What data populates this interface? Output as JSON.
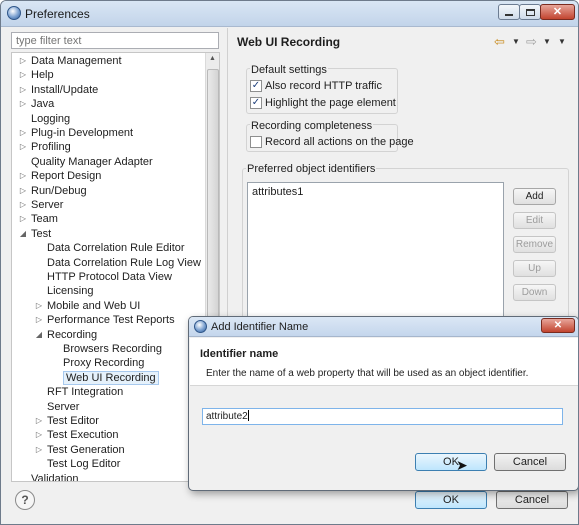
{
  "window": {
    "title": "Preferences"
  },
  "filter": {
    "placeholder": "type filter text"
  },
  "tree": [
    {
      "label": "Data Management",
      "indent": 0,
      "twisty": "collapsed"
    },
    {
      "label": "Help",
      "indent": 0,
      "twisty": "collapsed"
    },
    {
      "label": "Install/Update",
      "indent": 0,
      "twisty": "collapsed"
    },
    {
      "label": "Java",
      "indent": 0,
      "twisty": "collapsed"
    },
    {
      "label": "Logging",
      "indent": 0,
      "twisty": "none"
    },
    {
      "label": "Plug-in Development",
      "indent": 0,
      "twisty": "collapsed"
    },
    {
      "label": "Profiling",
      "indent": 0,
      "twisty": "collapsed"
    },
    {
      "label": "Quality Manager Adapter",
      "indent": 0,
      "twisty": "none"
    },
    {
      "label": "Report Design",
      "indent": 0,
      "twisty": "collapsed"
    },
    {
      "label": "Run/Debug",
      "indent": 0,
      "twisty": "collapsed"
    },
    {
      "label": "Server",
      "indent": 0,
      "twisty": "collapsed"
    },
    {
      "label": "Team",
      "indent": 0,
      "twisty": "collapsed"
    },
    {
      "label": "Test",
      "indent": 0,
      "twisty": "expanded"
    },
    {
      "label": "Data Correlation Rule Editor",
      "indent": 1,
      "twisty": "none"
    },
    {
      "label": "Data Correlation Rule Log View",
      "indent": 1,
      "twisty": "none"
    },
    {
      "label": "HTTP Protocol Data View",
      "indent": 1,
      "twisty": "none"
    },
    {
      "label": "Licensing",
      "indent": 1,
      "twisty": "none"
    },
    {
      "label": "Mobile and Web UI",
      "indent": 1,
      "twisty": "collapsed"
    },
    {
      "label": "Performance Test Reports",
      "indent": 1,
      "twisty": "collapsed"
    },
    {
      "label": "Recording",
      "indent": 1,
      "twisty": "expanded"
    },
    {
      "label": "Browsers Recording",
      "indent": 2,
      "twisty": "none"
    },
    {
      "label": "Proxy Recording",
      "indent": 2,
      "twisty": "none"
    },
    {
      "label": "Web UI Recording",
      "indent": 2,
      "twisty": "none",
      "selected": true
    },
    {
      "label": "RFT Integration",
      "indent": 1,
      "twisty": "none"
    },
    {
      "label": "Server",
      "indent": 1,
      "twisty": "none"
    },
    {
      "label": "Test Editor",
      "indent": 1,
      "twisty": "collapsed"
    },
    {
      "label": "Test Execution",
      "indent": 1,
      "twisty": "collapsed"
    },
    {
      "label": "Test Generation",
      "indent": 1,
      "twisty": "collapsed"
    },
    {
      "label": "Test Log Editor",
      "indent": 1,
      "twisty": "none"
    },
    {
      "label": "Validation",
      "indent": 0,
      "twisty": "none"
    }
  ],
  "page": {
    "title": "Web UI Recording",
    "default_settings": {
      "label": "Default settings",
      "options": [
        {
          "label": "Also record HTTP traffic",
          "checked": true
        },
        {
          "label": "Highlight the page element",
          "checked": true
        }
      ]
    },
    "recording_completeness": {
      "label": "Recording completeness",
      "options": [
        {
          "label": "Record all actions on the page",
          "checked": false
        }
      ]
    },
    "identifiers": {
      "label": "Preferred object identifiers",
      "items": [
        "attributes1"
      ],
      "buttons": {
        "add": "Add",
        "edit": "Edit",
        "remove": "Remove",
        "up": "Up",
        "down": "Down"
      }
    }
  },
  "footer": {
    "ok": "OK",
    "cancel": "Cancel"
  },
  "dialog": {
    "title": "Add Identifier Name",
    "heading": "Identifier name",
    "description": "Enter the name of a web property that will be used as an object identifier.",
    "value": "attribute2",
    "ok": "OK",
    "cancel": "Cancel"
  }
}
